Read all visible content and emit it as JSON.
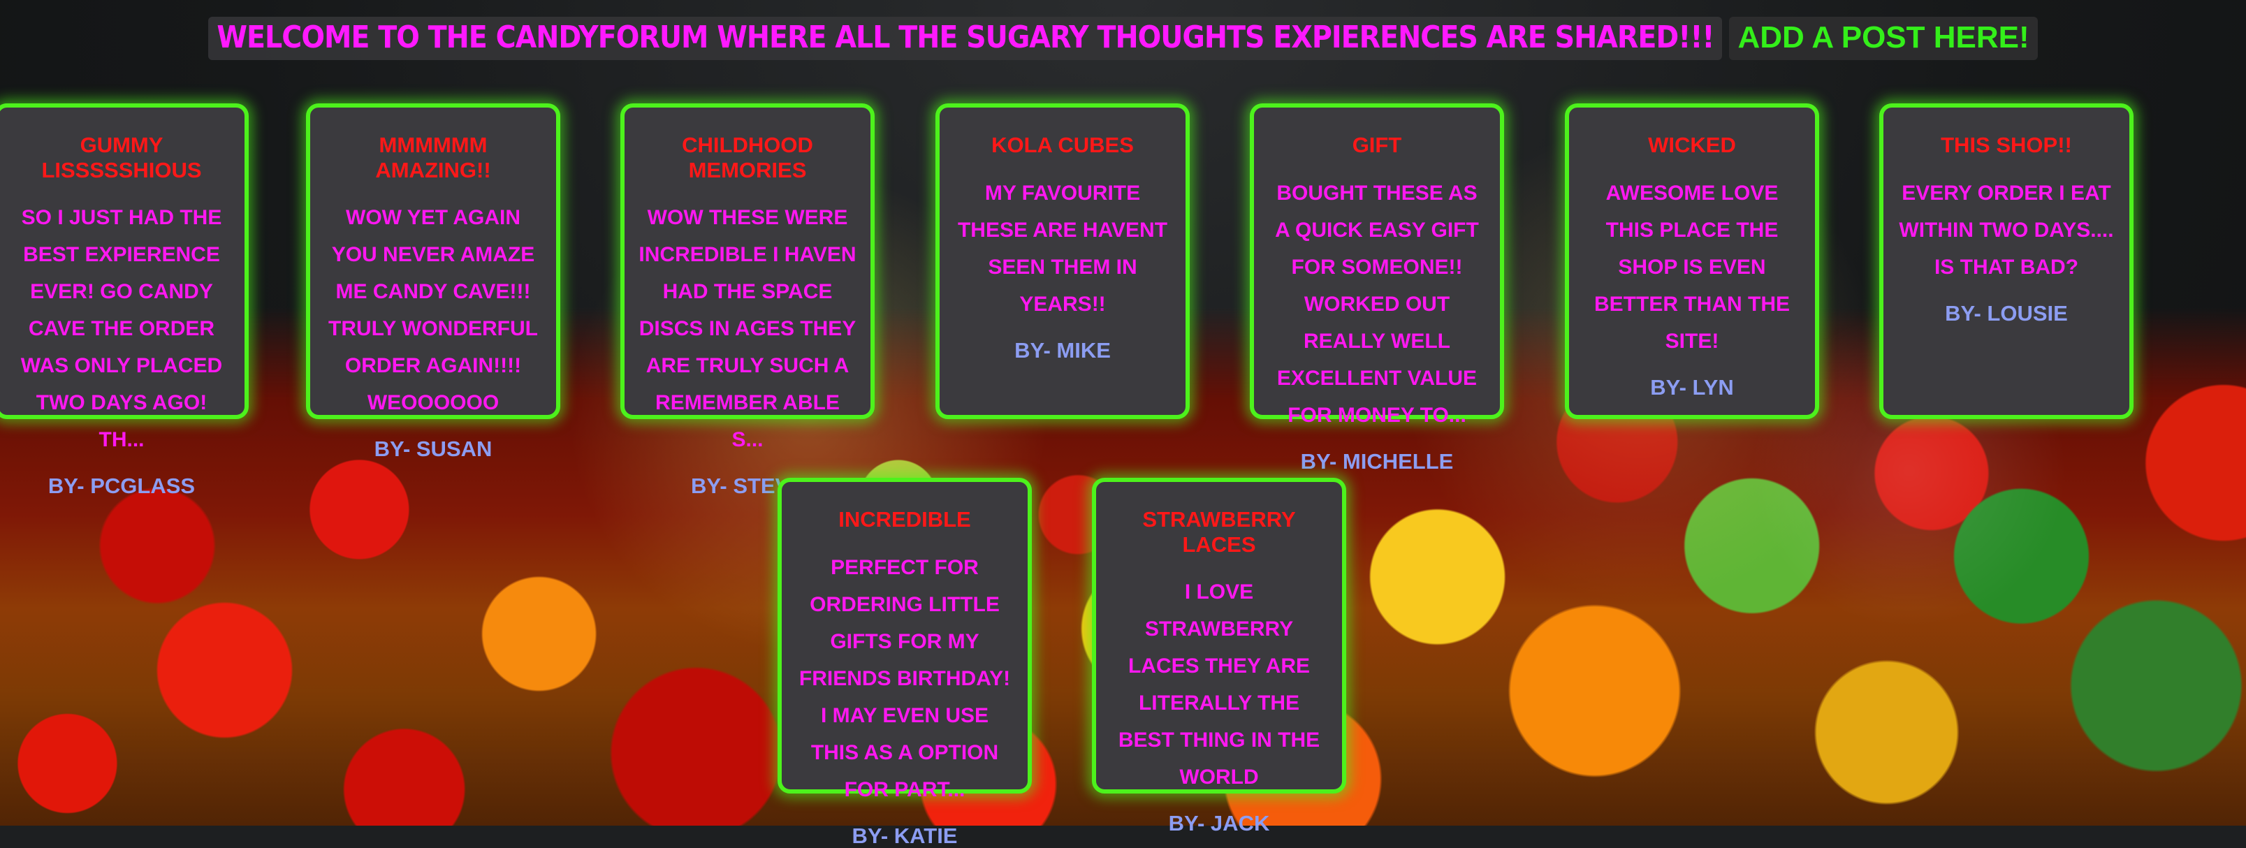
{
  "header": {
    "welcome_text": "WELCOME TO THE CANDYFORUM WHERE ALL THE SUGARY THOUGHTS EXPIERENCES ARE SHARED!!!",
    "add_post_label": "ADD A POST HERE!"
  },
  "posts": [
    {
      "title": "GUMMY LISSSSSHIOUS",
      "body": "SO I JUST HAD THE BEST EXPIERENCE EVER! GO CANDY CAVE THE ORDER WAS ONLY PLACED TWO DAYS AGO! TH...",
      "author": "BY- PCGLASS"
    },
    {
      "title": "MMMMMM AMAZING!!",
      "body": "WOW YET AGAIN YOU NEVER AMAZE ME CANDY CAVE!!! TRULY WONDERFUL ORDER AGAIN!!!! WEOOOOOO",
      "author": "BY- SUSAN"
    },
    {
      "title": "CHILDHOOD MEMORIES",
      "body": "WOW THESE WERE INCREDIBLE I HAVEN HAD THE SPACE DISCS IN AGES THEY ARE TRULY SUCH A REMEMBER ABLE S...",
      "author": "BY- STEVE"
    },
    {
      "title": "KOLA CUBES",
      "body": "MY FAVOURITE THESE ARE HAVENT SEEN THEM IN YEARS!!",
      "author": "BY- MIKE"
    },
    {
      "title": "GIFT",
      "body": "BOUGHT THESE AS A QUICK EASY GIFT FOR SOMEONE!! WORKED OUT REALLY WELL EXCELLENT VALUE FOR MONEY TO...",
      "author": "BY- MICHELLE"
    },
    {
      "title": "WICKED",
      "body": "AWESOME LOVE THIS PLACE THE SHOP IS EVEN BETTER THAN THE SITE!",
      "author": "BY- LYN"
    },
    {
      "title": "THIS SHOP!!",
      "body": "EVERY ORDER I EAT WITHIN TWO DAYS.... IS THAT BAD?",
      "author": "BY- LOUSIE"
    },
    {
      "title": "INCREDIBLE",
      "body": "PERFECT FOR ORDERING LITTLE GIFTS FOR MY FRIENDS BIRTHDAY! I MAY EVEN USE THIS AS A OPTION FOR PART...",
      "author": "BY- KATIE"
    },
    {
      "title": "STRAWBERRY LACES",
      "body": "I LOVE STRAWBERRY LACES THEY ARE LITERALLY THE BEST THING IN THE WORLD",
      "author": "BY- JACK"
    }
  ],
  "colors": {
    "welcome_text": "#ff19ff",
    "add_post_text": "#34ef1a",
    "card_border": "#4df21c",
    "card_bg": "#3b3a3e",
    "post_title": "#ff1818",
    "post_body": "#ff18f1",
    "post_author": "#8c9df2"
  }
}
